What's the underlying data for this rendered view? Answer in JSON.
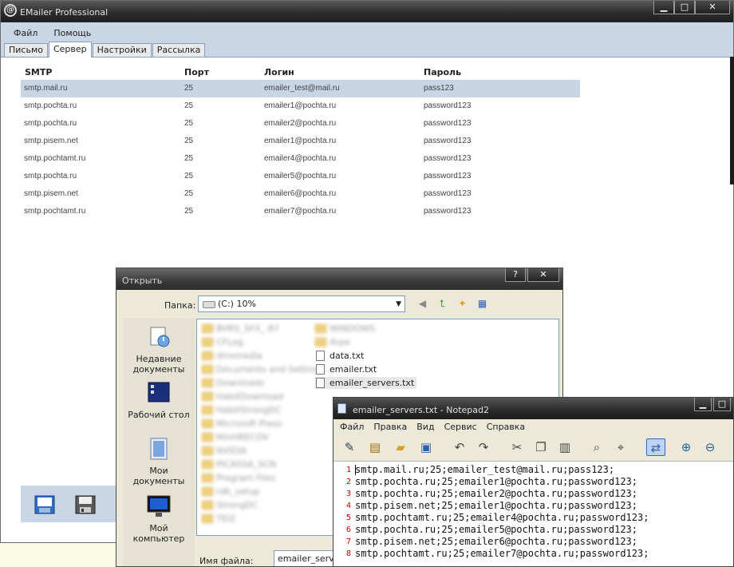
{
  "app": {
    "title": "EMailer Professional",
    "menu": [
      "Файл",
      "Помощь"
    ],
    "tabs": [
      "Письмо",
      "Сервер",
      "Настройки",
      "Рассылка"
    ],
    "active_tab": "Сервер",
    "window_buttons": {
      "minimize": "▁",
      "maximize": "□",
      "close": "✕"
    }
  },
  "grid": {
    "columns": [
      "SMTP",
      "Порт",
      "Логин",
      "Пароль"
    ],
    "rows": [
      {
        "smtp": "smtp.mail.ru",
        "port": "25",
        "login": "emailer_test@mail.ru",
        "password": "pass123"
      },
      {
        "smtp": "smtp.pochta.ru",
        "port": "25",
        "login": "emailer1@pochta.ru",
        "password": "password123"
      },
      {
        "smtp": "smtp.pochta.ru",
        "port": "25",
        "login": "emailer2@pochta.ru",
        "password": "password123"
      },
      {
        "smtp": "smtp.pisem.net",
        "port": "25",
        "login": "emailer1@pochta.ru",
        "password": "password123"
      },
      {
        "smtp": "smtp.pochtamt.ru",
        "port": "25",
        "login": "emailer4@pochta.ru",
        "password": "password123"
      },
      {
        "smtp": "smtp.pochta.ru",
        "port": "25",
        "login": "emailer5@pochta.ru",
        "password": "password123"
      },
      {
        "smtp": "smtp.pisem.net",
        "port": "25",
        "login": "emailer6@pochta.ru",
        "password": "password123"
      },
      {
        "smtp": "smtp.pochtamt.ru",
        "port": "25",
        "login": "emailer7@pochta.ru",
        "password": "password123"
      }
    ],
    "selected_row": 0
  },
  "open_dialog": {
    "title": "Открыть",
    "help_button": "?",
    "close_button": "✕",
    "folder_label": "Папка:",
    "folder_value": "(C:) 10%",
    "places": [
      "Недавние документы",
      "Рабочий стол",
      "Мои документы",
      "Мой компьютер"
    ],
    "files_visible": [
      "data.txt",
      "emailer.txt",
      "emailer_servers.txt"
    ],
    "selected_file": "emailer_servers.txt",
    "filename_label": "Имя файла:",
    "filename_value": "emailer_servers"
  },
  "notepad": {
    "title": "emailer_servers.txt - Notepad2",
    "menu": [
      "Файл",
      "Правка",
      "Вид",
      "Сервис",
      "Справка"
    ],
    "lines": [
      "smtp.mail.ru;25;emailer_test@mail.ru;pass123;",
      "smtp.pochta.ru;25;emailer1@pochta.ru;password123;",
      "smtp.pochta.ru;25;emailer2@pochta.ru;password123;",
      "smtp.pisem.net;25;emailer1@pochta.ru;password123;",
      "smtp.pochtamt.ru;25;emailer4@pochta.ru;password123;",
      "smtp.pochta.ru;25;emailer5@pochta.ru;password123;",
      "smtp.pisem.net;25;emailer6@pochta.ru;password123;",
      "smtp.pochtamt.ru;25;emailer7@pochta.ru;password123;"
    ],
    "line_numbers": [
      "1",
      "2",
      "3",
      "4",
      "5",
      "6",
      "7",
      "8"
    ]
  }
}
